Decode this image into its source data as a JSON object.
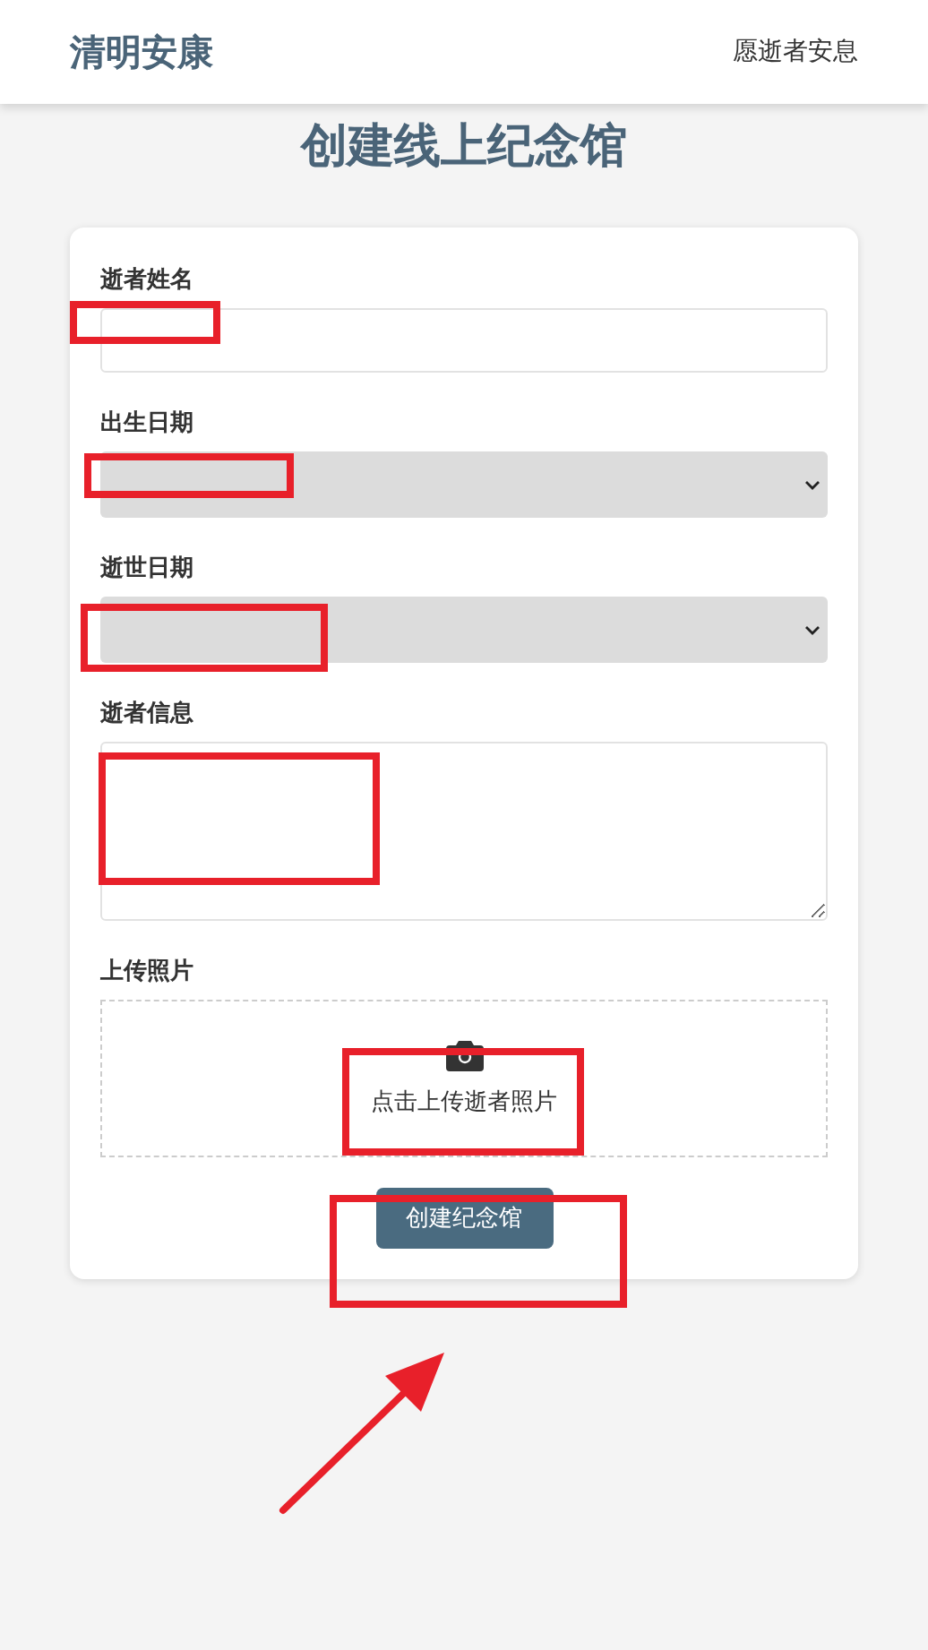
{
  "header": {
    "brand": "清明安康",
    "tagline": "愿逝者安息"
  },
  "page_title": "创建线上纪念馆",
  "form": {
    "fields": [
      {
        "kind": "text",
        "label": "逝者姓名"
      },
      {
        "kind": "select",
        "label": "出生日期"
      },
      {
        "kind": "select",
        "label": "逝世日期"
      },
      {
        "kind": "textarea",
        "label": "逝者信息"
      },
      {
        "kind": "upload",
        "label": "上传照片",
        "hint": "点击上传逝者照片"
      }
    ],
    "submit": "创建纪念馆"
  }
}
